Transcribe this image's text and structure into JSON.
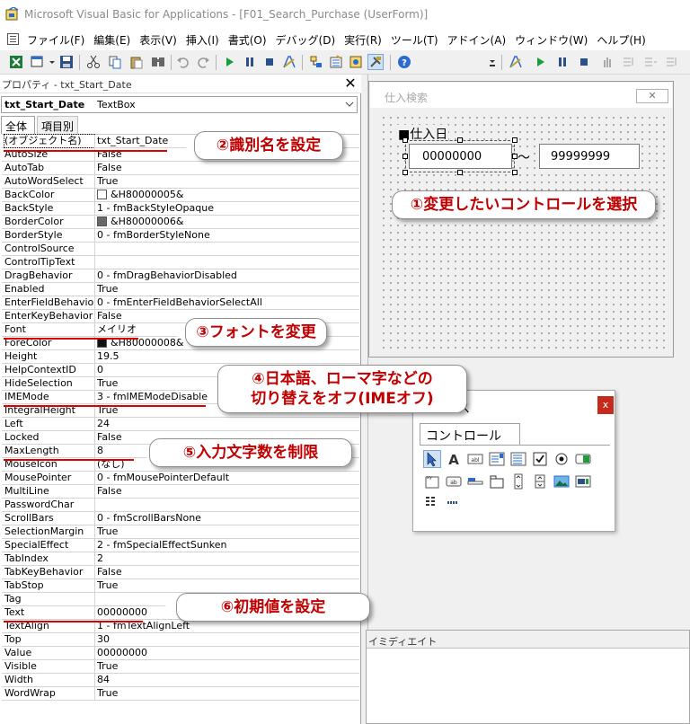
{
  "window": {
    "title": "Microsoft Visual Basic for Applications - [F01_Search_Purchase (UserForm)]"
  },
  "menu": [
    "ファイル(F)",
    "編集(E)",
    "表示(V)",
    "挿入(I)",
    "書式(O)",
    "デバッグ(D)",
    "実行(R)",
    "ツール(T)",
    "アドイン(A)",
    "ウィンドウ(W)",
    "ヘルプ(H)"
  ],
  "properties": {
    "title": "プロパティ - txt_Start_Date",
    "object_name": "txt_Start_Date",
    "object_type": "TextBox",
    "tabs": [
      "全体",
      "項目別"
    ],
    "rows": [
      [
        "(オブジェクト名)",
        "txt_Start_Date"
      ],
      [
        "AutoSize",
        "False"
      ],
      [
        "AutoTab",
        "False"
      ],
      [
        "AutoWordSelect",
        "True"
      ],
      [
        "BackColor",
        "&H80000005&"
      ],
      [
        "BackStyle",
        "1 - fmBackStyleOpaque"
      ],
      [
        "BorderColor",
        "&H80000006&"
      ],
      [
        "BorderStyle",
        "0 - fmBorderStyleNone"
      ],
      [
        "ControlSource",
        ""
      ],
      [
        "ControlTipText",
        ""
      ],
      [
        "DragBehavior",
        "0 - fmDragBehaviorDisabled"
      ],
      [
        "Enabled",
        "True"
      ],
      [
        "EnterFieldBehavior",
        "0 - fmEnterFieldBehaviorSelectAll"
      ],
      [
        "EnterKeyBehavior",
        "False"
      ],
      [
        "Font",
        "メイリオ"
      ],
      [
        "ForeColor",
        "&H80000008&"
      ],
      [
        "Height",
        "19.5"
      ],
      [
        "HelpContextID",
        "0"
      ],
      [
        "HideSelection",
        "True"
      ],
      [
        "IMEMode",
        "3 - fmIMEModeDisable"
      ],
      [
        "IntegralHeight",
        "True"
      ],
      [
        "Left",
        "24"
      ],
      [
        "Locked",
        "False"
      ],
      [
        "MaxLength",
        "8"
      ],
      [
        "MouseIcon",
        "(なし)"
      ],
      [
        "MousePointer",
        "0 - fmMousePointerDefault"
      ],
      [
        "MultiLine",
        "False"
      ],
      [
        "PasswordChar",
        ""
      ],
      [
        "ScrollBars",
        "0 - fmScrollBarsNone"
      ],
      [
        "SelectionMargin",
        "True"
      ],
      [
        "SpecialEffect",
        "2 - fmSpecialEffectSunken"
      ],
      [
        "TabIndex",
        "2"
      ],
      [
        "TabKeyBehavior",
        "False"
      ],
      [
        "TabStop",
        "True"
      ],
      [
        "Tag",
        ""
      ],
      [
        "Text",
        "00000000"
      ],
      [
        "TextAlign",
        "1 - fmTextAlignLeft"
      ],
      [
        "Top",
        "30"
      ],
      [
        "Value",
        "00000000"
      ],
      [
        "Visible",
        "True"
      ],
      [
        "Width",
        "84"
      ],
      [
        "WordWrap",
        "True"
      ]
    ],
    "swatches": {
      "BackColor": "#ffffff",
      "BorderColor": "#696969",
      "ForeColor": "#111111"
    }
  },
  "userform": {
    "title": "仕入検索",
    "close": "✕",
    "label": "■仕入日",
    "start_value": "00000000",
    "separator": "〜",
    "end_value": "99999999"
  },
  "toolbox": {
    "title": "ス",
    "close": "x",
    "tab": "コントロール"
  },
  "immediate": {
    "title": "イミディエイト"
  },
  "callouts": {
    "c1": "①変更したいコントロールを選択",
    "c2": "②識別名を設定",
    "c3": "③フォントを変更",
    "c4_line1": "④日本語、ローマ字などの",
    "c4_line2": "切り替えをオフ(IMEオフ)",
    "c5": "⑤入力文字数を制限",
    "c6": "⑥初期値を設定"
  },
  "colors": {
    "callout_text": "#c00000",
    "underline": "#e00000",
    "toolbox_close": "#c42b1c"
  }
}
